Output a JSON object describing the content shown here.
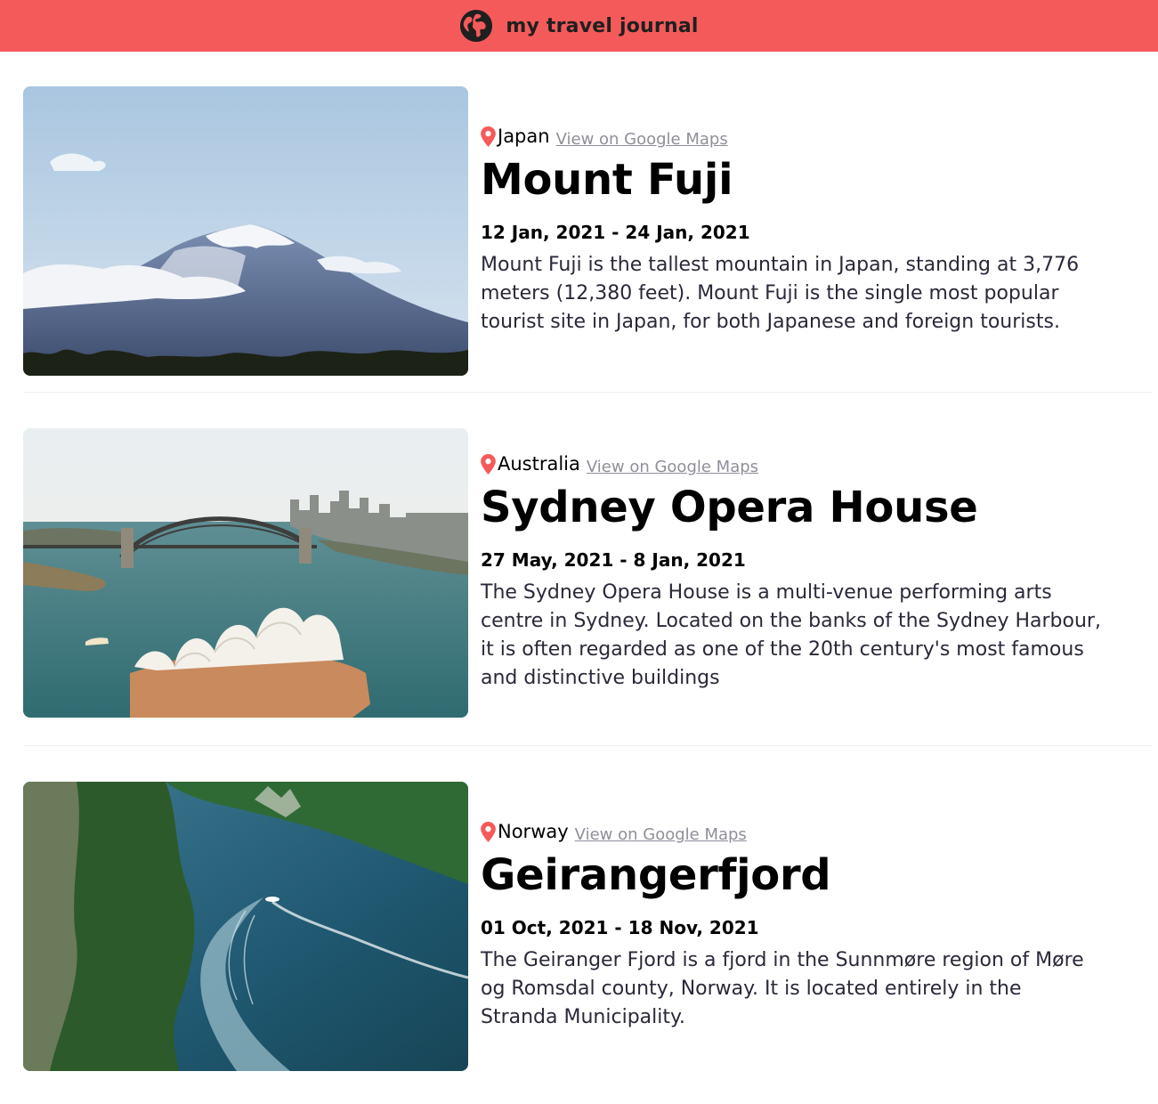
{
  "navbar": {
    "title": "my travel journal",
    "icon": "globe-icon",
    "background": "#F55A5A"
  },
  "entries": [
    {
      "country": "Japan",
      "maps_link": "View on Google Maps",
      "title": "Mount Fuji",
      "dates": "12 Jan, 2021 - 24 Jan, 2021",
      "description": "Mount Fuji is the tallest mountain in Japan, standing at 3,776 meters (12,380 feet). Mount Fuji is the single most popular tourist site in Japan, for both Japanese and foreign tourists."
    },
    {
      "country": "Australia",
      "maps_link": "View on Google Maps",
      "title": "Sydney Opera House",
      "dates": "27 May, 2021 - 8 Jan, 2021",
      "description": "The Sydney Opera House is a multi-venue performing arts centre in Sydney. Located on the banks of the Sydney Harbour, it is often regarded as one of the 20th century's most famous and distinctive buildings"
    },
    {
      "country": "Norway",
      "maps_link": "View on Google Maps",
      "title": "Geirangerfjord",
      "dates": "01 Oct, 2021 - 18 Nov, 2021",
      "description": "The Geiranger Fjord is a fjord in the Sunnmøre region of Møre og Romsdal county, Norway. It is located entirely in the Stranda Municipality."
    }
  ]
}
